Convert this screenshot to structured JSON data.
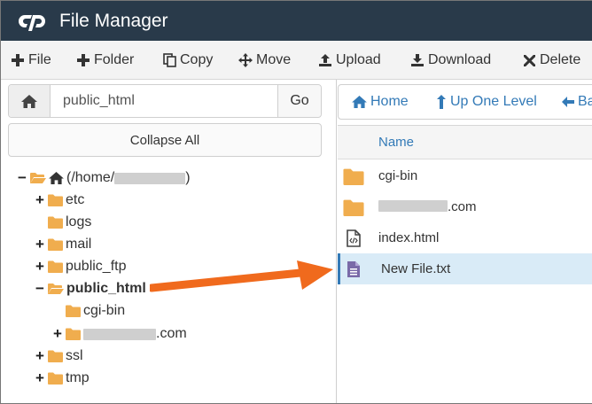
{
  "app": {
    "title": "File Manager",
    "logo": "cP"
  },
  "toolbar": {
    "items": [
      {
        "label": "File",
        "icon": "plus-icon"
      },
      {
        "label": "Folder",
        "icon": "plus-icon"
      },
      {
        "label": "Copy",
        "icon": "copy-icon"
      },
      {
        "label": "Move",
        "icon": "move-icon"
      },
      {
        "label": "Upload",
        "icon": "upload-icon"
      },
      {
        "label": "Download",
        "icon": "download-icon"
      },
      {
        "label": "Delete",
        "icon": "close-icon"
      }
    ]
  },
  "left": {
    "path_value": "public_html",
    "go_label": "Go",
    "collapse_label": "Collapse All",
    "tree": {
      "root_prefix": "(/home/",
      "root_suffix": ")",
      "items": [
        {
          "label": "etc",
          "sign": "+"
        },
        {
          "label": "logs",
          "sign": ""
        },
        {
          "label": "mail",
          "sign": "+"
        },
        {
          "label": "public_ftp",
          "sign": "+"
        },
        {
          "label": "public_html",
          "sign": "−"
        },
        {
          "label": "cgi-bin",
          "sign": ""
        },
        {
          "label": ".com",
          "sign": "+"
        },
        {
          "label": "ssl",
          "sign": "+"
        },
        {
          "label": "tmp",
          "sign": "+"
        }
      ]
    }
  },
  "right": {
    "nav": {
      "home": "Home",
      "up": "Up One Level",
      "back": "Ba"
    },
    "table": {
      "column_name": "Name",
      "rows": [
        {
          "name": "cgi-bin",
          "type": "folder"
        },
        {
          "name": ".com",
          "type": "folder"
        },
        {
          "name": "index.html",
          "type": "html"
        },
        {
          "name": "New File.txt",
          "type": "text",
          "selected": true
        }
      ]
    }
  },
  "colors": {
    "header": "#293a4a",
    "link": "#337ab7",
    "folder": "#f0ad4e",
    "arrow": "#f06a1d",
    "selected_row": "#d9ebf7"
  }
}
